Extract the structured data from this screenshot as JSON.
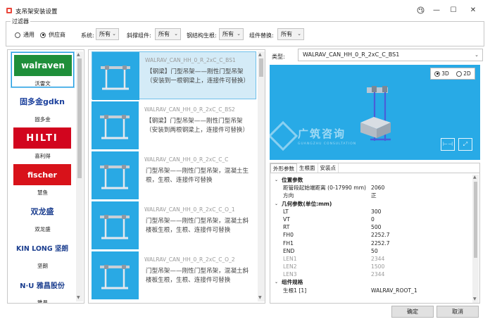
{
  "window": {
    "title": "支吊架安装设置",
    "controls": {
      "minimize": "—",
      "maximize": "☐",
      "close": "✕"
    }
  },
  "filter": {
    "legend": "过滤器",
    "radio_options": [
      {
        "label": "通用",
        "checked": false
      },
      {
        "label": "供应商",
        "checked": true
      }
    ],
    "fields": [
      {
        "label": "系统:",
        "value": "所有"
      },
      {
        "label": "斜撑组件:",
        "value": "所有"
      },
      {
        "label": "钢结构生根:",
        "value": "所有"
      },
      {
        "label": "组件替换:",
        "value": "所有"
      }
    ]
  },
  "brands": [
    {
      "logo_text": "walraven",
      "name": "沃雷文",
      "logo_color": "#ffffff",
      "logo_bg": "#1f8f3a",
      "selected": true
    },
    {
      "logo_text": "固多金gdkn",
      "name": "固多金",
      "logo_color": "#1a3f9c",
      "logo_bg": "#ffffff",
      "selected": false
    },
    {
      "logo_text": "HILTI",
      "name": "喜利得",
      "logo_color": "#ffffff",
      "logo_bg": "#d2051e",
      "selected": false
    },
    {
      "logo_text": "fischer",
      "name": "慧鱼",
      "logo_color": "#ffffff",
      "logo_bg": "#d8121a",
      "selected": false
    },
    {
      "logo_text": "双龙盛",
      "name": "双龙盛",
      "logo_color": "#1b3e8f",
      "logo_bg": "#ffffff",
      "selected": false
    },
    {
      "logo_text": "KIN LONG 坚朗",
      "name": "坚朗",
      "logo_color": "#1b3e8f",
      "logo_bg": "#ffffff",
      "selected": false
    },
    {
      "logo_text": "N·U 雅昌股份",
      "name": "雅昌",
      "logo_color": "#1b3e8f",
      "logo_bg": "#ffffff",
      "selected": false
    }
  ],
  "items": [
    {
      "code": "WALRAV_CAN_HH_0_R_2xC_C_BS1",
      "desc": "【钢梁】门型吊架——刚性门型吊架（安装到一根钢梁上，连接件可替换）",
      "selected": true
    },
    {
      "code": "WALRAV_CAN_HH_0_R_2xC_C_BS2",
      "desc": "【钢梁】门型吊架——刚性门型吊架（安装到两根钢梁上，连接件可替换）",
      "selected": false
    },
    {
      "code": "WALRAV_CAN_HH_0_R_2xC_C_C",
      "desc": "门型吊架——刚性门型吊架，混凝土生根，生根、连接件可替换",
      "selected": false
    },
    {
      "code": "WALRAV_CAN_HH_0_R_2xC_C_O_1",
      "desc": "门型吊架——刚性门型吊架，混凝土斜楼板生根，生根、连接件可替换",
      "selected": false
    },
    {
      "code": "WALRAV_CAN_HH_0_R_2xC_C_O_2",
      "desc": "门型吊架——刚性门型吊架，混凝土斜楼板生根，生根、连接件可替换",
      "selected": false
    }
  ],
  "type_selector": {
    "label": "类型:",
    "value": "WALRAV_CAN_HH_0_R_2xC_C_BS1"
  },
  "view": {
    "modes": [
      {
        "label": "3D",
        "checked": true
      },
      {
        "label": "2D",
        "checked": false
      }
    ],
    "watermark_cn": "广筑咨询",
    "watermark_en": "GUANGZHU CONSULTATION"
  },
  "props": {
    "tabs": [
      "外形参数",
      "生根面",
      "安装点"
    ],
    "active_tab": 0,
    "rows": [
      {
        "kind": "cat",
        "key": "位置参数"
      },
      {
        "kind": "row",
        "key": "距管段起始端距离 (0-17990 mm)",
        "value": "2060"
      },
      {
        "kind": "row",
        "key": "方向",
        "value": "正"
      },
      {
        "kind": "cat",
        "key": "几何参数(单位:mm)"
      },
      {
        "kind": "row",
        "key": "LT",
        "value": "300"
      },
      {
        "kind": "row",
        "key": "VT",
        "value": "0"
      },
      {
        "kind": "row",
        "key": "RT",
        "value": "500"
      },
      {
        "kind": "row",
        "key": "FH0",
        "value": "2252.7"
      },
      {
        "kind": "row",
        "key": "FH1",
        "value": "2252.7"
      },
      {
        "kind": "row",
        "key": "END",
        "value": "50"
      },
      {
        "kind": "muted",
        "key": "LEN1",
        "value": "2344"
      },
      {
        "kind": "muted",
        "key": "LEN2",
        "value": "1500"
      },
      {
        "kind": "muted",
        "key": "LEN3",
        "value": "2344"
      },
      {
        "kind": "cat",
        "key": "组件规格"
      },
      {
        "kind": "row",
        "key": "生根1 [1]",
        "value": "WALRAV_ROOT_1"
      }
    ]
  },
  "buttons": {
    "ok": "确定",
    "cancel": "取消"
  },
  "colors": {
    "accent": "#1e9be0",
    "viewport_bg": "#28aae6",
    "thumb_bg": "#29a9e4"
  }
}
